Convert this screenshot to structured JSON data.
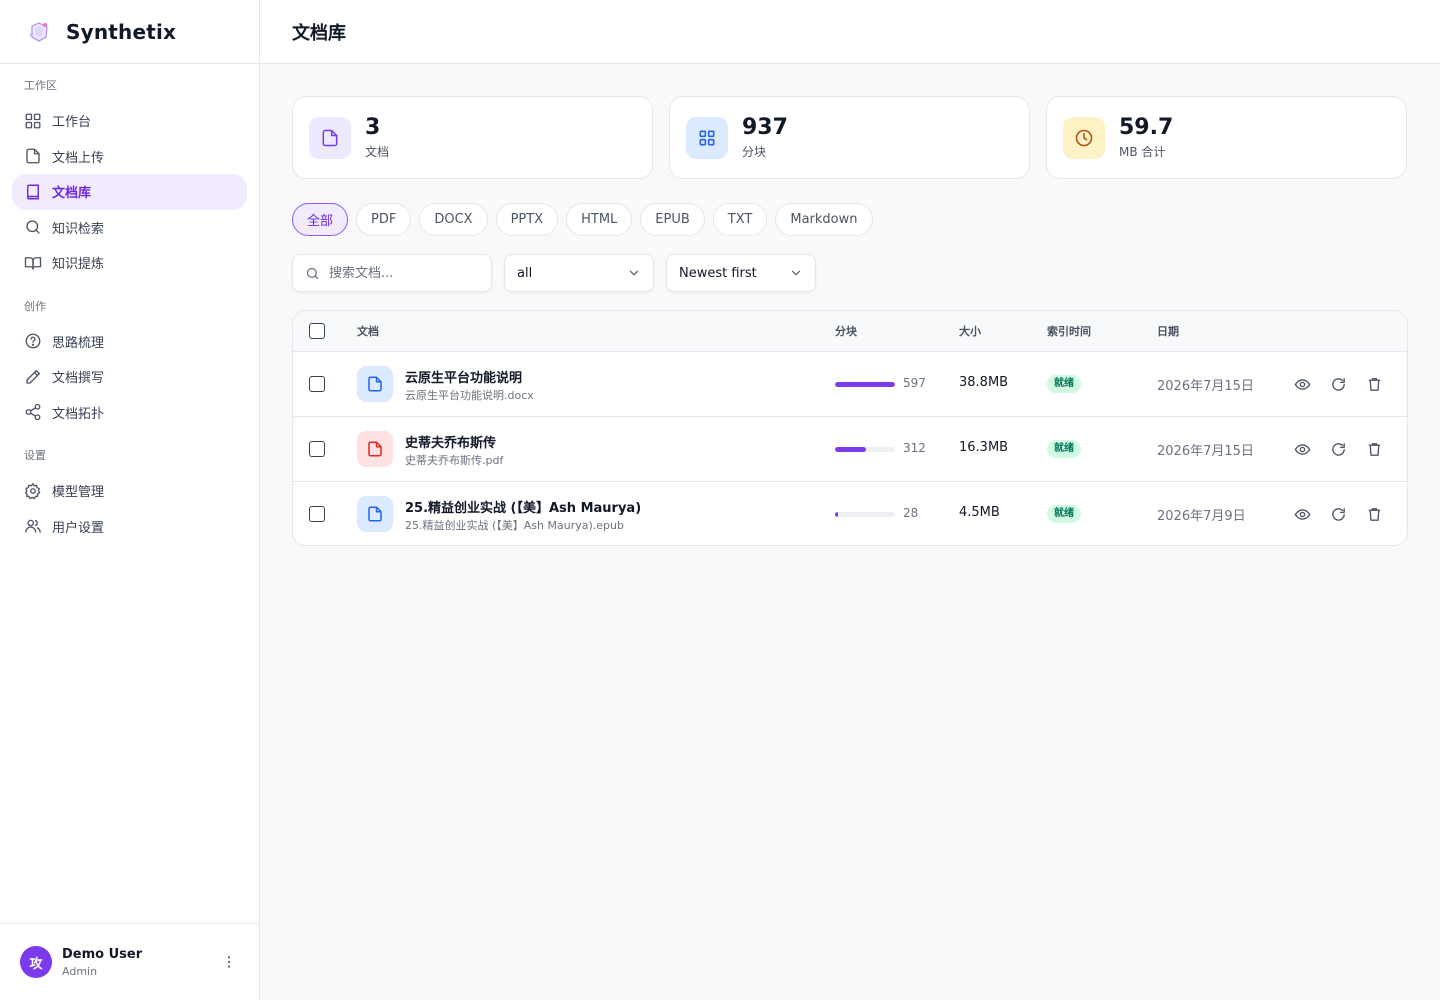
{
  "brand": {
    "name": "Synthetix"
  },
  "sidebar": {
    "sections": [
      {
        "title": "工作区",
        "items": [
          {
            "label": "工作台",
            "icon": "dashboard-grid-icon",
            "active": false
          },
          {
            "label": "文档上传",
            "icon": "file-icon",
            "active": false
          },
          {
            "label": "文档库",
            "icon": "book-icon",
            "active": true
          },
          {
            "label": "知识检索",
            "icon": "search-icon",
            "active": false
          },
          {
            "label": "知识提炼",
            "icon": "open-book-icon",
            "active": false
          }
        ]
      },
      {
        "title": "创作",
        "items": [
          {
            "label": "思路梳理",
            "icon": "help-circle-icon",
            "active": false
          },
          {
            "label": "文档撰写",
            "icon": "pencil-icon",
            "active": false
          },
          {
            "label": "文档拓扑",
            "icon": "share-icon",
            "active": false
          }
        ]
      },
      {
        "title": "设置",
        "items": [
          {
            "label": "模型管理",
            "icon": "gear-icon",
            "active": false
          },
          {
            "label": "用户设置",
            "icon": "users-icon",
            "active": false
          }
        ]
      }
    ]
  },
  "user": {
    "avatar_text": "攻",
    "name": "Demo User",
    "role": "Admin"
  },
  "page": {
    "title": "文档库"
  },
  "stats": [
    {
      "value": "3",
      "label": "文档",
      "icon": "file-icon",
      "color": "#7c3aed",
      "bg": "#ede9fe"
    },
    {
      "value": "937",
      "label": "分块",
      "icon": "grid-icon",
      "color": "#2563eb",
      "bg": "#dbeafe"
    },
    {
      "value": "59.7",
      "label": "MB 合计",
      "icon": "clock-icon",
      "color": "#b45309",
      "bg": "#fef3c7"
    }
  ],
  "filters": {
    "types": [
      "全部",
      "PDF",
      "DOCX",
      "PPTX",
      "HTML",
      "EPUB",
      "TXT",
      "Markdown"
    ],
    "active_type": "全部",
    "search_placeholder": "搜索文档...",
    "status_value": "all",
    "sort_value": "Newest first"
  },
  "table": {
    "columns": {
      "doc": "文档",
      "chunks": "分块",
      "size": "大小",
      "indexed": "索引时间",
      "date": "日期"
    },
    "rows": [
      {
        "name": "云原生平台功能说明",
        "file": "云原生平台功能说明.docx",
        "type": "docx",
        "chunks": 597,
        "chunks_text": "597",
        "size": "38.8MB",
        "status": "就绪",
        "date": "2026年7月15日"
      },
      {
        "name": "史蒂夫乔布斯传",
        "file": "史蒂夫乔布斯传.pdf",
        "type": "pdf",
        "chunks": 312,
        "chunks_text": "312",
        "size": "16.3MB",
        "status": "就绪",
        "date": "2026年7月15日"
      },
      {
        "name": "25.精益创业实战 (【美】Ash Maurya)",
        "file": "25.精益创业实战 (【美】Ash Maurya).epub",
        "type": "epub",
        "chunks": 28,
        "chunks_text": "28",
        "size": "4.5MB",
        "status": "就绪",
        "date": "2026年7月9日"
      }
    ],
    "max_chunks": 597
  },
  "colors": {
    "accent": "#7c3aed",
    "accent_bg": "#f1ebfd",
    "ready_bg": "#d1fae5",
    "ready_text": "#047857"
  }
}
